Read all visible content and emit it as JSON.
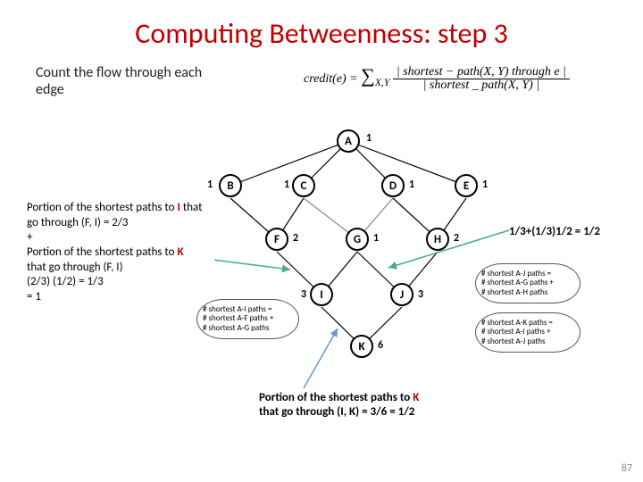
{
  "title": "Computing Betweenness: step 3",
  "subtitle": "Count the flow through each edge",
  "formula": {
    "lhs": "credit(e) = ",
    "sum_sub": "X,Y",
    "num": "| shortest − path(X, Y) through e |",
    "den": "| shortest _ path(X, Y) |"
  },
  "note_left": {
    "l1a": "Portion of the shortest paths to ",
    "l1b": "I",
    "l1c": " that go through (F, I) = 2/3",
    "plus": "+",
    "l2a": "Portion of the shortest paths to ",
    "l2b": "K",
    "l2c": " that go through (F, I)",
    "l3": "(2/3) (1/2) = 1/3",
    "l4": "= 1"
  },
  "note_right": "1/3+(1/3)1/2 = 1/2",
  "note_bottom": {
    "a": "Portion of the shortest paths to ",
    "b": "K",
    "c": " that go through (I, K) = 3/6 = 1/2"
  },
  "slidenum": "87",
  "nodes": {
    "A": "A",
    "B": "B",
    "C": "C",
    "D": "D",
    "E": "E",
    "F": "F",
    "G": "G",
    "H": "H",
    "I": "I",
    "J": "J",
    "K": "K"
  },
  "weights": {
    "A": "1",
    "B": "1",
    "C": "1",
    "D": "1",
    "E": "1",
    "F": "2",
    "G": "1",
    "H": "2",
    "I": "3",
    "J": "3",
    "K": "6"
  },
  "cloud_left": "# shortest A-I paths =\n# shortest A-F paths +\n# shortest A-G paths",
  "cloud_right_top": "# shortest A-J paths =\n# shortest A-G paths +\n# shortest A-H paths",
  "cloud_right_bot": "# shortest A-K paths =\n# shortest A-I paths +\n# shortest A-J paths"
}
